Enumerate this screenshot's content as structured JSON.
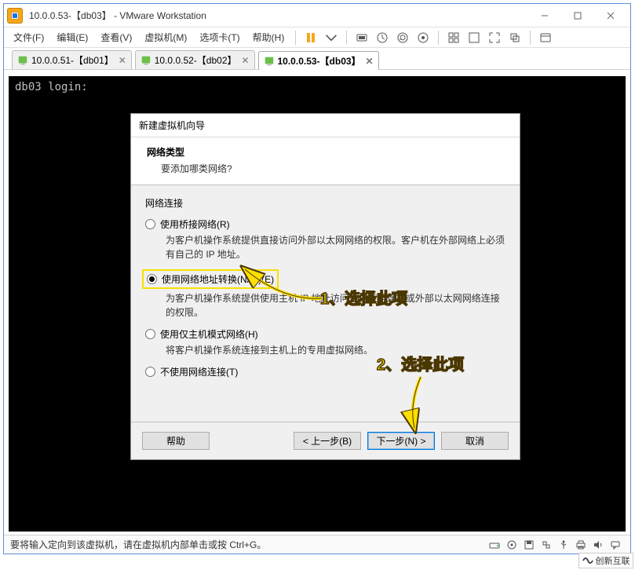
{
  "window": {
    "title": "10.0.0.53-【db03】   - VMware Workstation"
  },
  "menu": {
    "file": "文件(F)",
    "edit": "编辑(E)",
    "view": "查看(V)",
    "vm": "虚拟机(M)",
    "tabs": "选项卡(T)",
    "help": "帮助(H)"
  },
  "tabs": [
    {
      "label": "10.0.0.51-【db01】"
    },
    {
      "label": "10.0.0.52-【db02】"
    },
    {
      "label": "10.0.0.53-【db03】"
    }
  ],
  "console": {
    "line1": "db03 login:"
  },
  "dialog": {
    "title": "新建虚拟机向导",
    "header_title": "网络类型",
    "header_sub": "要添加哪类网络?",
    "group": "网络连接",
    "opt_bridged": "使用桥接网络(R)",
    "opt_bridged_desc": "为客户机操作系统提供直接访问外部以太网网络的权限。客户机在外部网络上必须有自己的 IP 地址。",
    "opt_nat": "使用网络地址转换(NAT)(E)",
    "opt_nat_desc": "为客户机操作系统提供使用主机 IP 地址访问主机拨号连接或外部以太网网络连接的权限。",
    "opt_host": "使用仅主机模式网络(H)",
    "opt_host_desc": "将客户机操作系统连接到主机上的专用虚拟网络。",
    "opt_none": "不使用网络连接(T)",
    "btn_help": "帮助",
    "btn_back": "< 上一步(B)",
    "btn_next": "下一步(N) >",
    "btn_cancel": "取消"
  },
  "annotations": {
    "a1": "1、选择此项",
    "a2": "2、选择此项"
  },
  "statusbar": {
    "text": "要将输入定向到该虚拟机，请在虚拟机内部单击或按 Ctrl+G。"
  },
  "watermark": {
    "text": "创新互联"
  }
}
